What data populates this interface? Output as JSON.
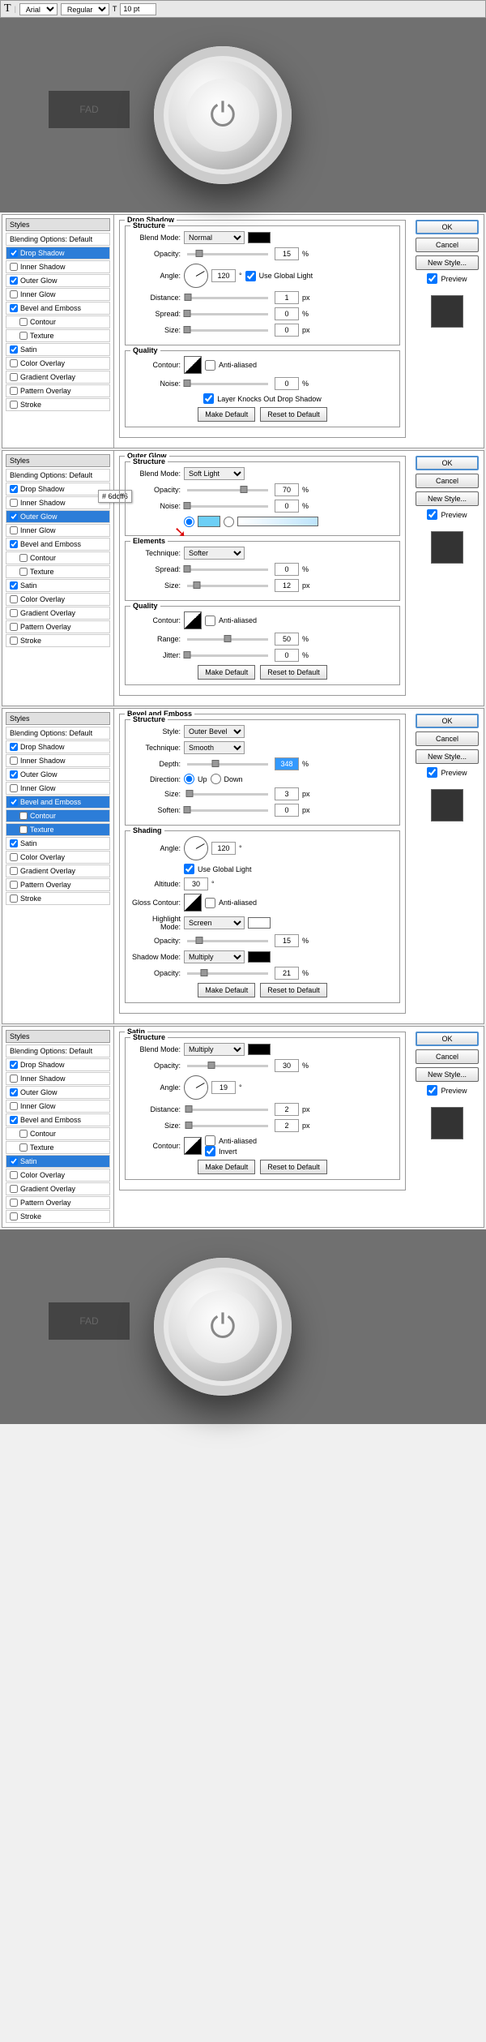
{
  "topbar": {
    "font": "Arial",
    "weight": "Regular",
    "size": "10 pt"
  },
  "styles_header": "Styles",
  "blending_default": "Blending Options: Default",
  "style_names": {
    "drop_shadow": "Drop Shadow",
    "inner_shadow": "Inner Shadow",
    "outer_glow": "Outer Glow",
    "inner_glow": "Inner Glow",
    "bevel_emboss": "Bevel and Emboss",
    "contour": "Contour",
    "texture": "Texture",
    "satin": "Satin",
    "color_overlay": "Color Overlay",
    "gradient_overlay": "Gradient Overlay",
    "pattern_overlay": "Pattern Overlay",
    "stroke": "Stroke"
  },
  "buttons": {
    "ok": "OK",
    "cancel": "Cancel",
    "new_style": "New Style...",
    "preview": "Preview",
    "make_default": "Make Default",
    "reset_default": "Reset to Default"
  },
  "labels": {
    "blend_mode": "Blend Mode:",
    "opacity": "Opacity:",
    "angle": "Angle:",
    "distance": "Distance:",
    "spread": "Spread:",
    "size": "Size:",
    "contour": "Contour:",
    "noise": "Noise:",
    "use_global": "Use Global Light",
    "anti_aliased": "Anti-aliased",
    "knocks_out": "Layer Knocks Out Drop Shadow",
    "technique": "Technique:",
    "range": "Range:",
    "jitter": "Jitter:",
    "style": "Style:",
    "depth": "Depth:",
    "direction": "Direction:",
    "up": "Up",
    "down": "Down",
    "soften": "Soften:",
    "altitude": "Altitude:",
    "gloss_contour": "Gloss Contour:",
    "highlight_mode": "Highlight Mode:",
    "shadow_mode": "Shadow Mode:",
    "invert": "Invert"
  },
  "groups": {
    "drop_shadow": "Drop Shadow",
    "outer_glow": "Outer Glow",
    "bevel_emboss": "Bevel and Emboss",
    "satin": "Satin",
    "structure": "Structure",
    "quality": "Quality",
    "elements": "Elements",
    "shading": "Shading"
  },
  "panel1": {
    "blend_mode": "Normal",
    "opacity": "15",
    "angle": "120",
    "distance": "1",
    "spread": "0",
    "size": "0",
    "noise": "0"
  },
  "panel2": {
    "blend_mode": "Soft Light",
    "opacity": "70",
    "noise": "0",
    "technique": "Softer",
    "spread": "0",
    "size": "12",
    "range": "50",
    "jitter": "0",
    "tip": "#  6dcff6"
  },
  "panel3": {
    "style": "Outer Bevel",
    "technique": "Smooth",
    "depth": "348",
    "size": "3",
    "soften": "0",
    "angle": "120",
    "altitude": "30",
    "highlight_mode": "Screen",
    "highlight_opacity": "15",
    "shadow_mode": "Multiply",
    "shadow_opacity": "21"
  },
  "panel4": {
    "blend_mode": "Multiply",
    "opacity": "30",
    "angle": "19",
    "distance": "2",
    "size": "2"
  },
  "fad": "FAD",
  "unit_pct": "%",
  "unit_px": "px",
  "unit_deg": "°"
}
